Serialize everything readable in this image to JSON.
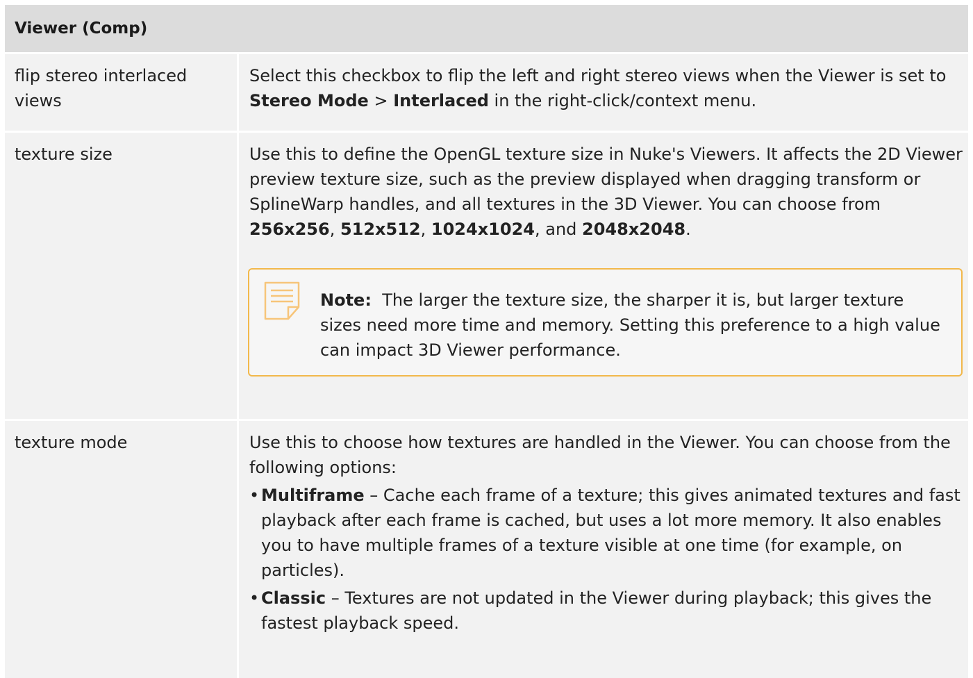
{
  "header": {
    "title": "Viewer (Comp)"
  },
  "rows": [
    {
      "label": "flip stereo interlaced views",
      "desc": {
        "t1": "Select this checkbox to flip the left and right stereo views when the Viewer is set to ",
        "b1": "Stereo Mode",
        "t2": " > ",
        "b2": "Interlaced",
        "t3": " in the right-click/context menu."
      }
    },
    {
      "label": "texture size",
      "desc": {
        "t1": "Use this to define the OpenGL texture size in Nuke's Viewers. It affects the 2D Viewer preview texture size, such as the preview displayed when dragging transform or SplineWarp handles, and all textures in the 3D Viewer. You can choose from ",
        "b1": "256x256",
        "t2": ", ",
        "b2": "512x512",
        "t3": ", ",
        "b3": "1024x1024",
        "t4": ", and ",
        "b4": "2048x2048",
        "t5": "."
      },
      "note": {
        "label": "Note:",
        "text": "The larger the texture size, the sharper it is, but larger texture sizes need more time and memory. Setting this preference to a high value can impact 3D Viewer performance.",
        "icon": "note-icon",
        "border_color": "#f2b84b"
      }
    },
    {
      "label": "texture mode",
      "desc": {
        "intro": "Use this to choose how textures are handled in the Viewer. You can choose from the following options:"
      },
      "options": [
        {
          "bullet": "•",
          "name": "Multiframe",
          "text": " – Cache each frame of a texture; this gives animated textures and fast playback after each frame is cached, but uses a lot more memory. It also enables you to have multiple frames of a texture visible at one time (for example, on particles)."
        },
        {
          "bullet": "•",
          "name": "Classic",
          "text": " – Textures are not updated in the Viewer during playback; this gives the fastest playback speed."
        }
      ]
    }
  ]
}
